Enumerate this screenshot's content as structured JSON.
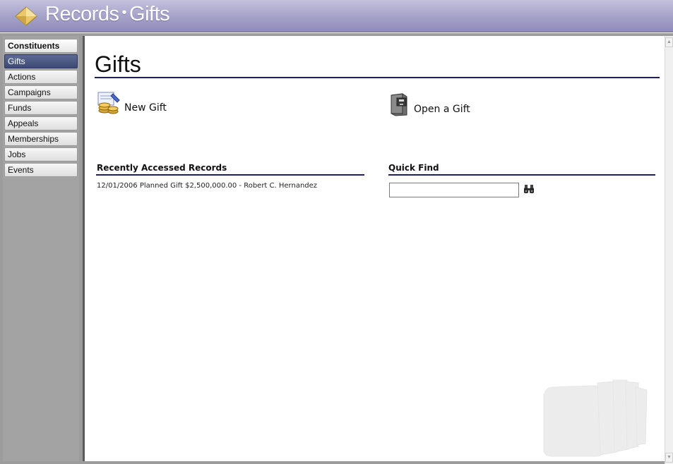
{
  "titlebar": {
    "section": "Records",
    "separator": "•",
    "page": "Gifts",
    "logo_icon": "diamond-logo-icon"
  },
  "sidebar": {
    "items": [
      {
        "label": "Constituents",
        "state": "header"
      },
      {
        "label": "Gifts",
        "state": "active"
      },
      {
        "label": "Actions",
        "state": "normal"
      },
      {
        "label": "Campaigns",
        "state": "normal"
      },
      {
        "label": "Funds",
        "state": "normal"
      },
      {
        "label": "Appeals",
        "state": "normal"
      },
      {
        "label": "Memberships",
        "state": "normal"
      },
      {
        "label": "Jobs",
        "state": "normal"
      },
      {
        "label": "Events",
        "state": "normal"
      }
    ]
  },
  "main": {
    "title": "Gifts",
    "actions": {
      "new_gift": {
        "label": "New Gift",
        "icon": "new-gift-coins-icon"
      },
      "open_gift": {
        "label": "Open a Gift",
        "icon": "file-cabinet-icon"
      }
    },
    "recent": {
      "heading": "Recently Accessed Records",
      "items": [
        "12/01/2006 Planned Gift $2,500,000.00 - Robert C. Hernandez"
      ]
    },
    "quick_find": {
      "heading": "Quick Find",
      "value": "",
      "placeholder": "",
      "icon": "binoculars-icon"
    }
  },
  "colors": {
    "titlebar": "#a9a6cc",
    "accent_rule": "#1c1f6b",
    "active_nav": "#3d4a75"
  }
}
